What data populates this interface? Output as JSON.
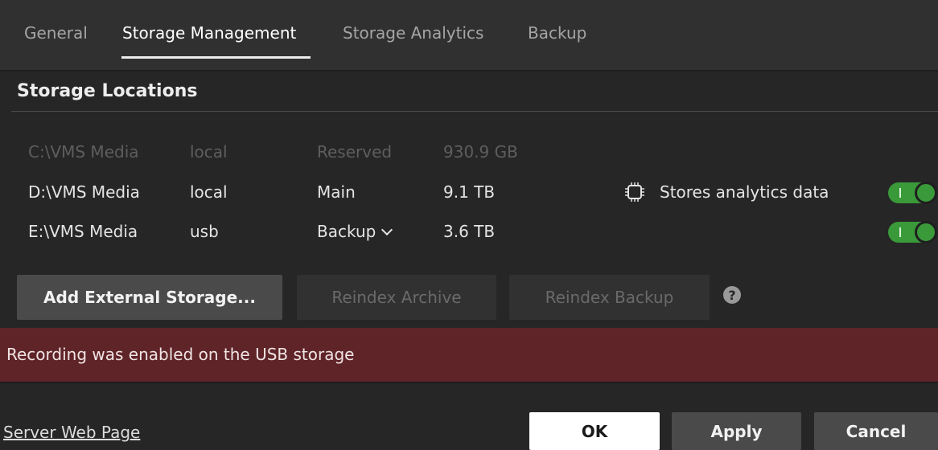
{
  "tabs": [
    {
      "label": "General",
      "active": false
    },
    {
      "label": "Storage Management",
      "active": true
    },
    {
      "label": "Storage Analytics",
      "active": false
    },
    {
      "label": "Backup",
      "active": false
    }
  ],
  "section": {
    "title": "Storage Locations"
  },
  "storages": [
    {
      "path": "C:\\VMS Media",
      "type": "local",
      "role": "Reserved",
      "size": "930.9 GB",
      "enabled": false
    },
    {
      "path": "D:\\VMS Media",
      "type": "local",
      "role": "Main",
      "size": "9.1 TB",
      "enabled": true,
      "analytics_label": "Stores analytics data",
      "analytics_icon": "chip-icon",
      "toggle_on": true
    },
    {
      "path": "E:\\VMS Media",
      "type": "usb",
      "role": "Backup",
      "role_dropdown": true,
      "size": "3.6 TB",
      "enabled": true,
      "toggle_on": true
    }
  ],
  "actions": {
    "add_external": "Add External Storage...",
    "reindex_archive": "Reindex Archive",
    "reindex_backup": "Reindex Backup",
    "help_icon": "?"
  },
  "alert": {
    "text": "Recording was enabled on the USB storage",
    "color": "#5f2428"
  },
  "footer": {
    "link": "Server Web Page",
    "ok": "OK",
    "apply": "Apply",
    "cancel": "Cancel"
  },
  "colors": {
    "background": "#262626",
    "tabbar": "#303030",
    "toggle_on": "#3a9a3a"
  }
}
